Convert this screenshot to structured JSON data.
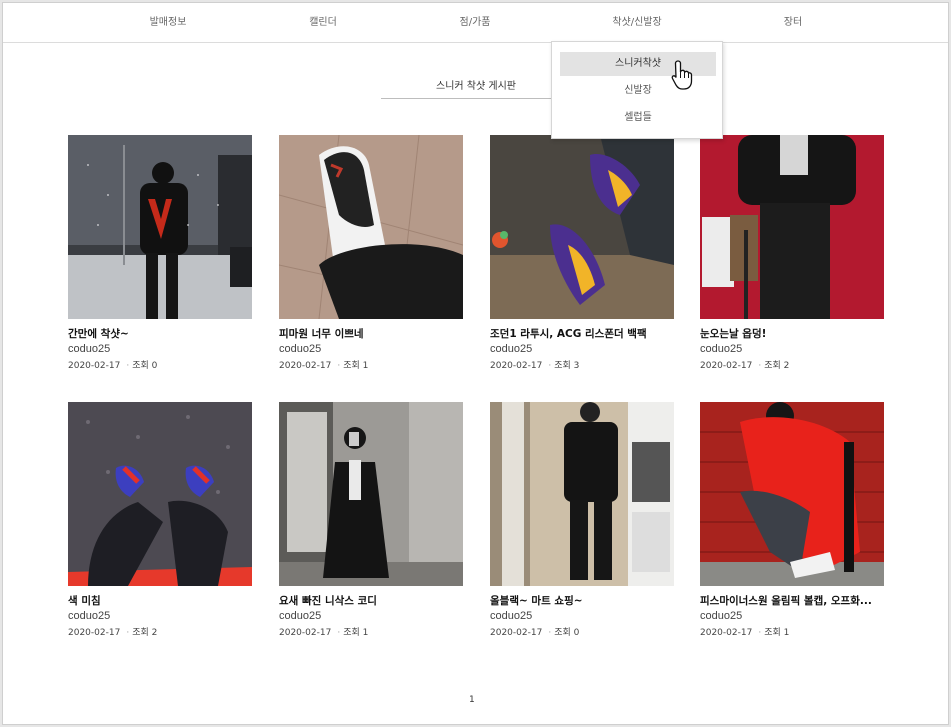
{
  "nav": {
    "items": [
      {
        "label": "발매정보"
      },
      {
        "label": "캘린더"
      },
      {
        "label": "점/가품"
      },
      {
        "label": "착샷/신발장"
      },
      {
        "label": "장터"
      }
    ]
  },
  "dropdown": {
    "items": [
      {
        "label": "스니커착샷"
      },
      {
        "label": "신발장"
      },
      {
        "label": "셀럽들"
      }
    ]
  },
  "board": {
    "title": "스니커 착샷 게시판"
  },
  "posts": [
    {
      "title": "간만에 착샷~",
      "author": "coduo25",
      "date": "2020-02-17",
      "views": "조회 0"
    },
    {
      "title": "피마원 너무 이쁘네",
      "author": "coduo25",
      "date": "2020-02-17",
      "views": "조회 1"
    },
    {
      "title": "조던1 라투시, ACG 리스폰더 백팩",
      "author": "coduo25",
      "date": "2020-02-17",
      "views": "조회 3"
    },
    {
      "title": "눈오는날 옵덩!",
      "author": "coduo25",
      "date": "2020-02-17",
      "views": "조회 2"
    },
    {
      "title": "색 미침",
      "author": "coduo25",
      "date": "2020-02-17",
      "views": "조회 2"
    },
    {
      "title": "요새 빠진 니삭스 코디",
      "author": "coduo25",
      "date": "2020-02-17",
      "views": "조회 1"
    },
    {
      "title": "올블랙~ 마트 쇼핑~",
      "author": "coduo25",
      "date": "2020-02-17",
      "views": "조회 0"
    },
    {
      "title": "피스마이너스원 올림픽 볼캡, 오프화...",
      "author": "coduo25",
      "date": "2020-02-17",
      "views": "조회 1"
    }
  ],
  "pagination": {
    "current": "1"
  },
  "colors": {
    "active_menu_bg": "#e3e3e3",
    "divider": "#dcdcdc"
  }
}
